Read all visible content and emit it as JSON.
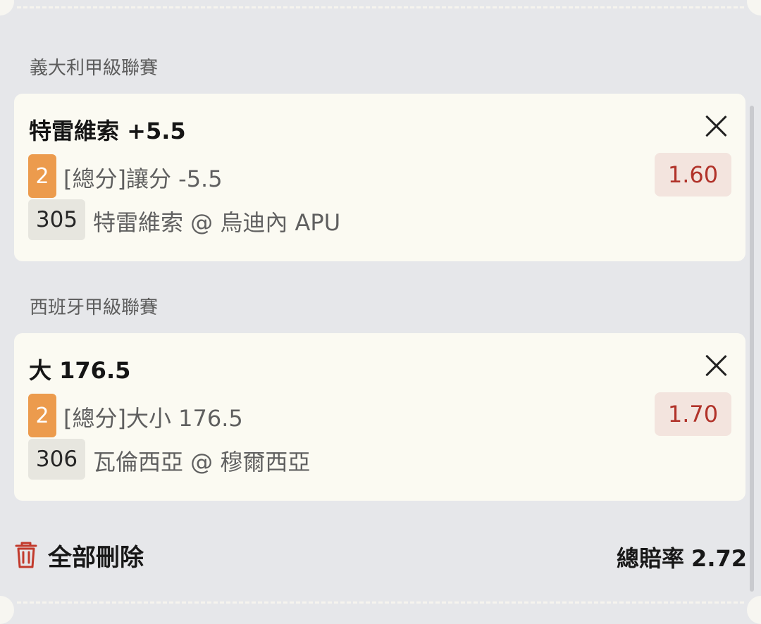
{
  "slips": [
    {
      "league": "義大利甲級聯賽",
      "selection": "特雷維索 +5.5",
      "period": "2",
      "market": "[總分]讓分 -5.5",
      "odds": "1.60",
      "match_id": "305",
      "match": "特雷維索 @ 烏迪內 APU"
    },
    {
      "league": "西班牙甲級聯賽",
      "selection": "大 176.5",
      "period": "2",
      "market": "[總分]大小 176.5",
      "odds": "1.70",
      "match_id": "306",
      "match": "瓦倫西亞 @ 穆爾西亞"
    }
  ],
  "footer": {
    "delete_all_label": "全部刪除",
    "total_odds_label": "總賠率",
    "total_odds_value": "2.72"
  },
  "colors": {
    "accent_orange": "#ec9b4d",
    "odds_red": "#b1332a",
    "delete_icon_red": "#c23a2c"
  },
  "icons": {
    "close": "close-icon",
    "delete": "trash-icon"
  }
}
